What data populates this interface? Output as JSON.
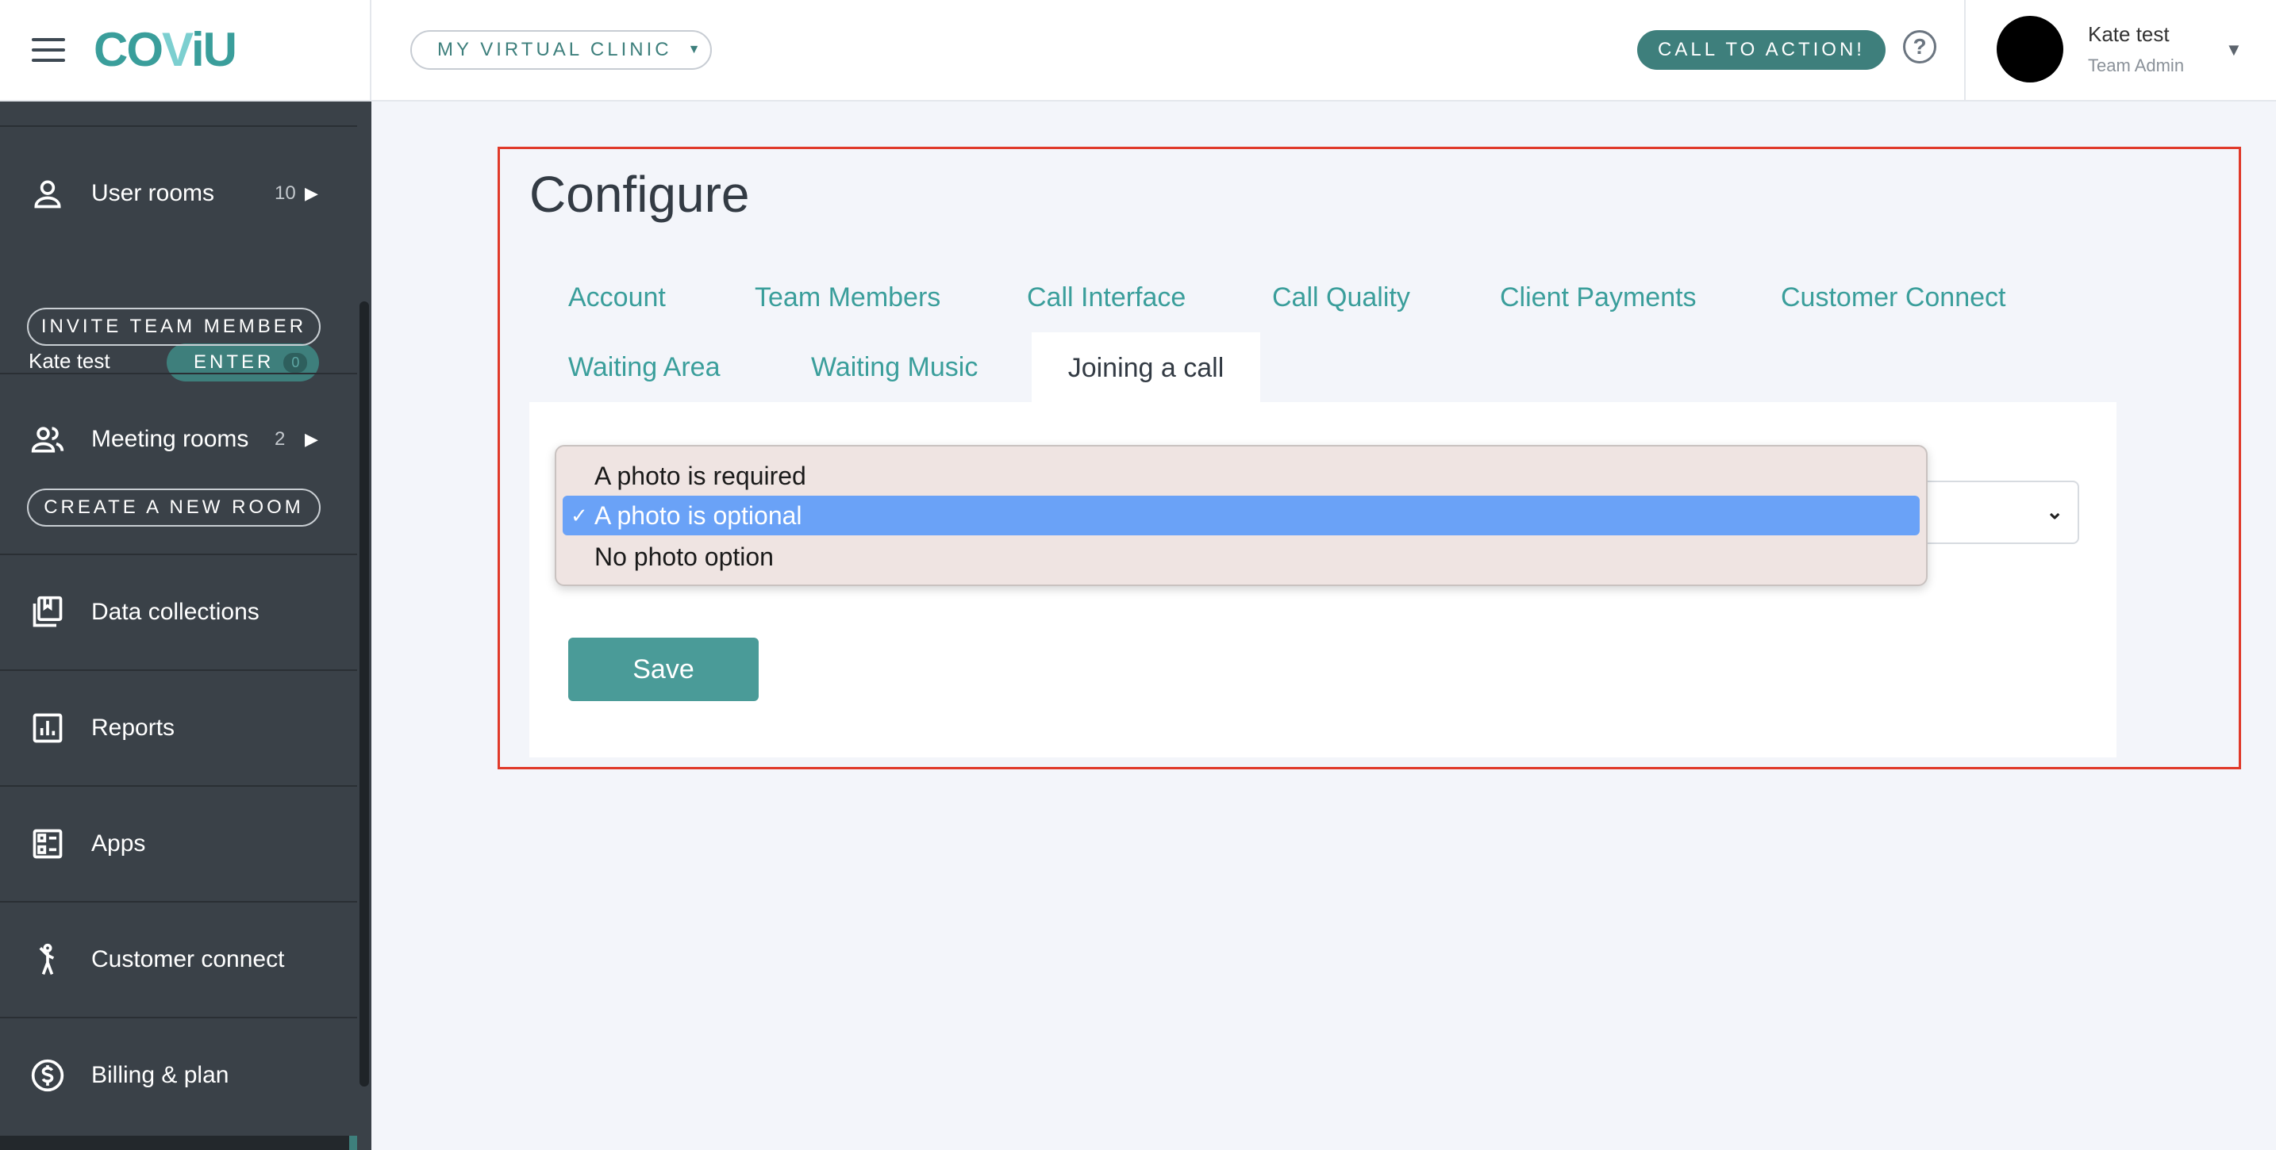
{
  "header": {
    "logo": {
      "part1": "CO",
      "part2": "V",
      "part3": "iU"
    },
    "clinic_select": "MY VIRTUAL CLINIC",
    "cta": "CALL TO ACTION!",
    "help": "?",
    "user": {
      "name": "Kate test",
      "role": "Team Admin"
    }
  },
  "sidebar": {
    "user_rooms": {
      "label": "User rooms",
      "count": "10"
    },
    "room_owner": "Kate test",
    "enter_label": "ENTER",
    "enter_badge": "0",
    "invite_label": "INVITE TEAM MEMBER",
    "meeting_rooms": {
      "label": "Meeting rooms",
      "count": "2"
    },
    "create_room_label": "CREATE A NEW ROOM",
    "items": [
      {
        "label": "Data collections",
        "icon": "library-icon"
      },
      {
        "label": "Reports",
        "icon": "reports-icon"
      },
      {
        "label": "Apps",
        "icon": "apps-icon"
      },
      {
        "label": "Customer connect",
        "icon": "person-waving-icon"
      },
      {
        "label": "Billing & plan",
        "icon": "dollar-circle-icon"
      }
    ]
  },
  "main": {
    "title": "Configure",
    "tabs": [
      {
        "label": "Account"
      },
      {
        "label": "Team Members"
      },
      {
        "label": "Call Interface"
      },
      {
        "label": "Call Quality"
      },
      {
        "label": "Client Payments"
      },
      {
        "label": "Customer Connect"
      },
      {
        "label": "Waiting Area"
      },
      {
        "label": "Waiting Music"
      },
      {
        "label": "Joining a call"
      }
    ],
    "active_tab": "Joining a call",
    "dropdown": {
      "options": [
        "A photo is required",
        "A photo is optional",
        "No photo option"
      ],
      "selected": "A photo is optional",
      "check": "✓"
    },
    "save_label": "Save"
  },
  "colors": {
    "accent": "#3e7f7c",
    "sidebar": "#3a4148",
    "highlight": "#e03a2a",
    "selected_option": "#6aa2f7"
  }
}
